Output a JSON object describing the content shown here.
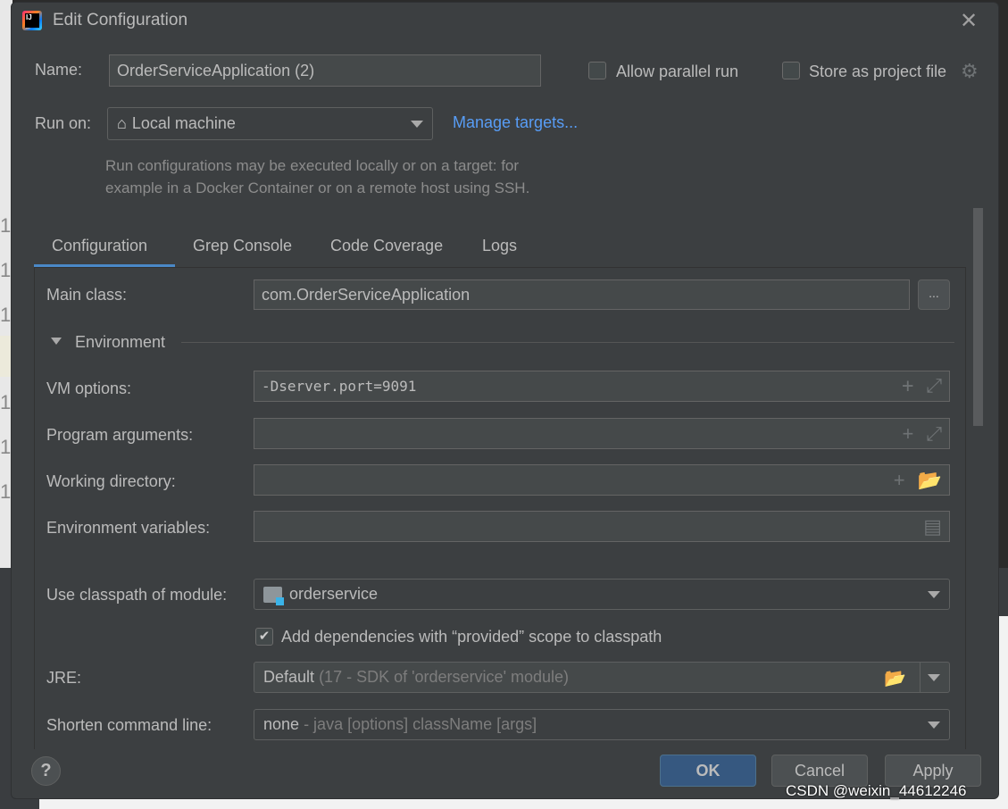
{
  "dialog": {
    "title": "Edit Configuration",
    "close_icon": "close-icon"
  },
  "name": {
    "label": "Name:",
    "value": "OrderServiceApplication (2)"
  },
  "allow_parallel": {
    "label": "Allow parallel run",
    "checked": false
  },
  "store_project": {
    "label": "Store as project file",
    "checked": false
  },
  "run_on": {
    "label": "Run on:",
    "value": "Local machine",
    "manage": "Manage targets...",
    "hint1": "Run configurations may be executed locally or on a target: for",
    "hint2": "example in a Docker Container or on a remote host using SSH."
  },
  "tabs": [
    {
      "label": "Configuration",
      "active": true
    },
    {
      "label": "Grep Console"
    },
    {
      "label": "Code Coverage"
    },
    {
      "label": "Logs"
    }
  ],
  "main_class": {
    "label": "Main class:",
    "value": "com.OrderServiceApplication",
    "browse": "..."
  },
  "environment": {
    "label": "Environment",
    "expanded": true
  },
  "vm_options": {
    "label": "VM options:",
    "value": "-Dserver.port=9091"
  },
  "program_args": {
    "label": "Program arguments:",
    "value": ""
  },
  "working_dir": {
    "label": "Working directory:",
    "value": ""
  },
  "env_vars": {
    "label": "Environment variables:",
    "value": ""
  },
  "classpath": {
    "label": "Use classpath of module:",
    "value": "orderservice"
  },
  "provided": {
    "label": "Add dependencies with “provided” scope to classpath",
    "checked": true
  },
  "jre": {
    "label": "JRE:",
    "value": "Default",
    "detail": "(17 - SDK of 'orderservice' module)"
  },
  "shorten": {
    "label": "Shorten command line:",
    "value": "none",
    "detail": "- java [options] className [args]"
  },
  "buttons": {
    "help": "?",
    "ok": "OK",
    "cancel": "Cancel",
    "apply": "Apply"
  },
  "watermark": "CSDN @weixin_44612246",
  "colors": {
    "accent": "#4a88c7",
    "link": "#589df6",
    "ok_button": "#365880",
    "dialog_bg": "#3c3f41"
  }
}
